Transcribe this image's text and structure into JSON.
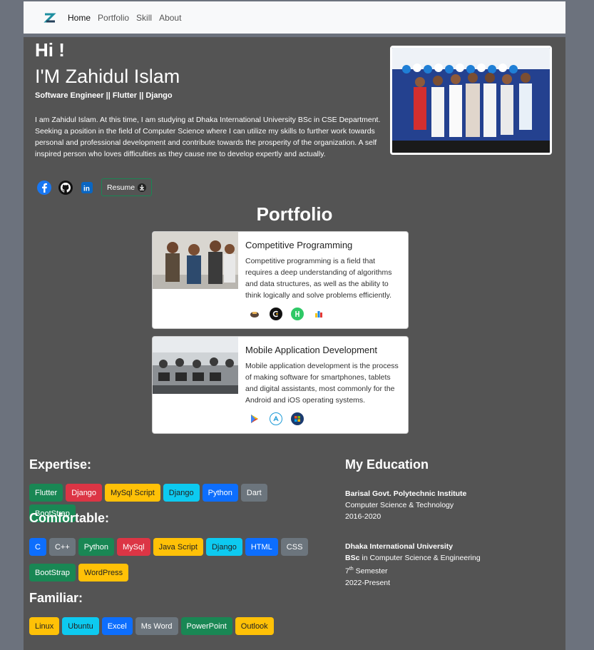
{
  "nav": {
    "brand_letter": "Z",
    "links": [
      "Home",
      "Portfolio",
      "Skill",
      "About"
    ]
  },
  "hero": {
    "greeting": "Hi !",
    "name": "I'M Zahidul Islam",
    "role": "Software Engineer || Flutter || Django",
    "bio": "I am Zahidul Islam. At this time, I am studying at Dhaka International University BSc in CSE Department. Seeking a position in the field of Computer Science where I can utilize my skills to further work towards personal and professional development and contribute towards the prosperity of the organization. A self inspired person who loves difficulties as they cause me to develop expertly and actually.",
    "socials": [
      "facebook-icon",
      "github-icon",
      "linkedin-icon"
    ],
    "resume_label": "Resume"
  },
  "portfolio": {
    "title": "Portfolio",
    "cards": [
      {
        "title": "Competitive Programming",
        "text": "Competitive programming is a field that requires a deep understanding of algorithms and data structures, as well as the ability to think logically and solve problems efficiently."
      },
      {
        "title": "Mobile Application Development",
        "text": "Mobile application development is the process of making software for smartphones, tablets and digital assistants, most commonly for the Android and iOS operating systems."
      }
    ]
  },
  "skills": {
    "expertise_title": "Expertise:",
    "expertise": [
      "Flutter",
      "Django",
      "MySql Script",
      "Django",
      "Python",
      "Dart",
      "BootStrap"
    ],
    "comfortable_title": "Comfortable:",
    "comfortable": [
      "C",
      "C++",
      "Python",
      "MySql",
      "Java Script",
      "Django",
      "HTML",
      "CSS",
      "BootStrap",
      "WordPress"
    ],
    "familiar_title": "Familiar:",
    "familiar": [
      "Linux",
      "Ubuntu",
      "Excel",
      "Ms Word",
      "PowerPoint",
      "Outlook"
    ]
  },
  "education": {
    "title": "My Education",
    "entries": [
      {
        "institute": "Barisal Govt. Polytechnic Institute",
        "degree": "Computer Science & Technology",
        "years": "2016-2020"
      },
      {
        "institute": "Dhaka International University",
        "degree_bold": "BSc",
        "degree": " in Computer Science & Engineering",
        "semester_num": "7",
        "semester_sup": "th",
        "semester": " Semester",
        "years": "2022-Present"
      }
    ]
  },
  "colors": {
    "page_bg": "#6c727d",
    "content_bg": "#545454",
    "green": "#198754",
    "red": "#dc3545",
    "yellow": "#ffc107",
    "cyan": "#0dcaf0",
    "blue": "#0d6efd",
    "gray": "#6c757d"
  }
}
